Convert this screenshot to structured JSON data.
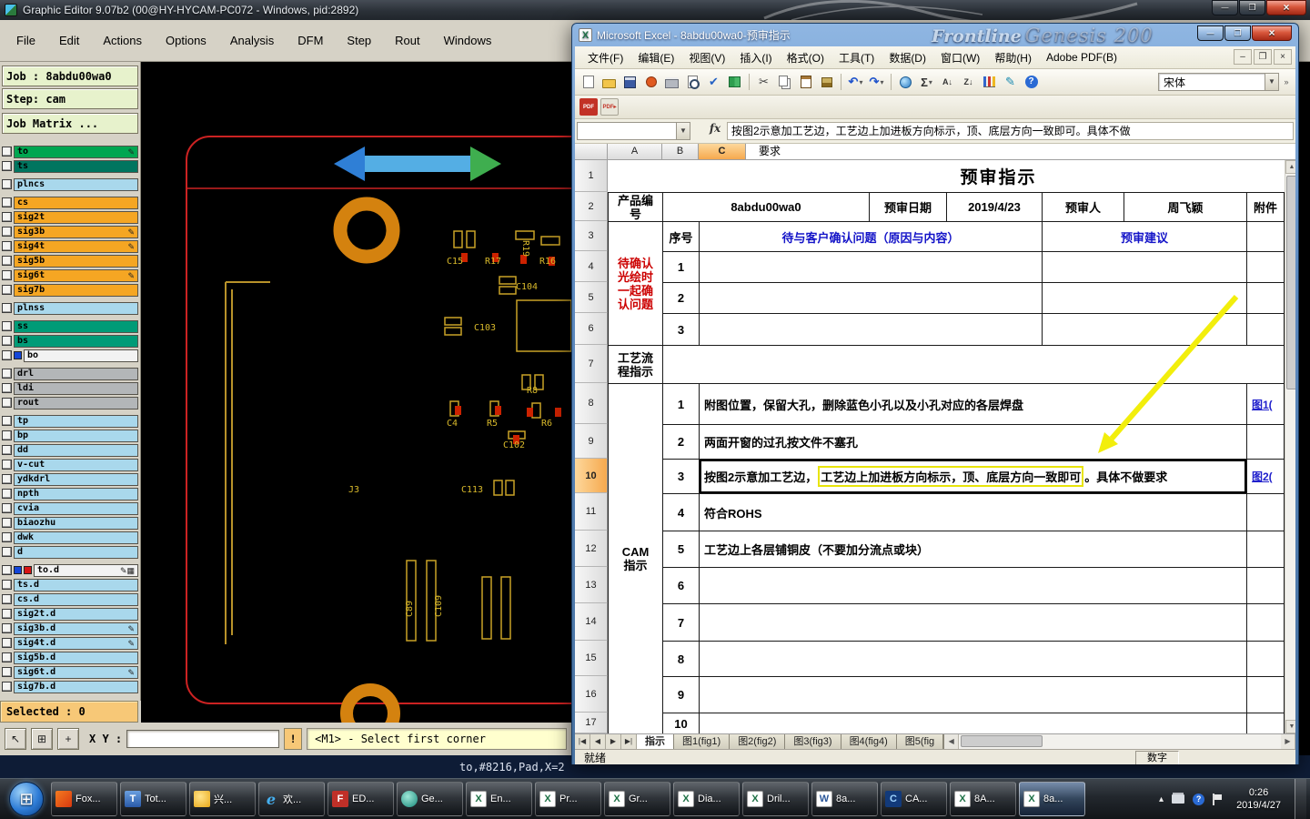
{
  "wallpaper": {
    "brand_italic": "Frontline",
    "brand_rest": "Genesis 200"
  },
  "graphic_editor": {
    "title": "Graphic Editor 9.07b2 (00@HY-HYCAM-PC072 - Windows, pid:2892)",
    "menu_items": [
      "File",
      "Edit",
      "Actions",
      "Options",
      "Analysis",
      "DFM",
      "Step",
      "Rout",
      "Windows"
    ],
    "job_line": "Job : 8abdu00wa0",
    "step_line": "Step: cam",
    "job_matrix_label": "Job Matrix ...",
    "pencil_glyph": "✎",
    "grid_glyph": "▦",
    "layers": [
      {
        "name": "to",
        "color": "#00a651"
      },
      {
        "name": "ts",
        "color": "#00755f"
      },
      {
        "name": "plncs",
        "color": "#a9d8ec"
      },
      {
        "name": "cs",
        "color": "#f5a623"
      },
      {
        "name": "sig2t",
        "color": "#f5a623"
      },
      {
        "name": "sig3b",
        "color": "#f5a623"
      },
      {
        "name": "sig4t",
        "color": "#f5a623"
      },
      {
        "name": "sig5b",
        "color": "#f5a623"
      },
      {
        "name": "sig6t",
        "color": "#f5a623"
      },
      {
        "name": "sig7b",
        "color": "#f5a623"
      },
      {
        "name": "plnss",
        "color": "#a9d8ec"
      },
      {
        "name": "ss",
        "color": "#009b77"
      },
      {
        "name": "bs",
        "color": "#009b77"
      },
      {
        "name": "bo",
        "color": "#f2f2f2"
      },
      {
        "name": "drl",
        "color": "#b3b6b8"
      },
      {
        "name": "ldi",
        "color": "#b3b6b8"
      },
      {
        "name": "rout",
        "color": "#b3b6b8"
      },
      {
        "name": "tp",
        "color": "#a9d8ec"
      },
      {
        "name": "bp",
        "color": "#a9d8ec"
      },
      {
        "name": "dd",
        "color": "#a9d8ec"
      },
      {
        "name": "v-cut",
        "color": "#a9d8ec"
      },
      {
        "name": "ydkdrl",
        "color": "#a9d8ec"
      },
      {
        "name": "npth",
        "color": "#a9d8ec"
      },
      {
        "name": "cvia",
        "color": "#a9d8ec"
      },
      {
        "name": "biaozhu",
        "color": "#a9d8ec"
      },
      {
        "name": "dwk",
        "color": "#a9d8ec"
      },
      {
        "name": "d",
        "color": "#a9d8ec"
      },
      {
        "name": "to.d",
        "color": "#f2f2f2"
      },
      {
        "name": "ts.d",
        "color": "#a9d8ec"
      },
      {
        "name": "cs.d",
        "color": "#a9d8ec"
      },
      {
        "name": "sig2t.d",
        "color": "#a9d8ec"
      },
      {
        "name": "sig3b.d",
        "color": "#a9d8ec"
      },
      {
        "name": "sig4t.d",
        "color": "#a9d8ec"
      },
      {
        "name": "sig5b.d",
        "color": "#a9d8ec"
      },
      {
        "name": "sig6t.d",
        "color": "#a9d8ec"
      },
      {
        "name": "sig7b.d",
        "color": "#a9d8ec"
      }
    ],
    "selected_label": "Selected : 0",
    "xy_label": "X Y :",
    "xy_value": "",
    "alert_glyph": "!",
    "status_message": "<M1> - Select first corner",
    "coord_readout": "to,#8216,Pad,X=2",
    "pcb_labels": [
      "C15",
      "R17",
      "R16",
      "R19",
      "C104",
      "C103",
      "R8",
      "C4",
      "R5",
      "R6",
      "C102",
      "J3",
      "C113",
      "C89",
      "C109"
    ]
  },
  "excel": {
    "window_title": "Microsoft Excel - 8abdu00wa0-预审指示",
    "menu_items": [
      "文件(F)",
      "编辑(E)",
      "视图(V)",
      "插入(I)",
      "格式(O)",
      "工具(T)",
      "数据(D)",
      "窗口(W)",
      "帮助(H)",
      "Adobe PDF(B)"
    ],
    "font_name": "宋体",
    "name_box": "",
    "fx_label": "fx",
    "formula_line1": "按图2示意加工艺边，工艺边上加进板方向标示，顶、底层方向一致即可。具体不做",
    "formula_line2": "要求",
    "col_headers": [
      "A",
      "B",
      "C"
    ],
    "row_headers": [
      "1",
      "2",
      "3",
      "4",
      "5",
      "6",
      "7",
      "8",
      "9",
      "10",
      "11",
      "12",
      "13",
      "14",
      "15",
      "16",
      "17"
    ],
    "table": {
      "title": "预审指示",
      "product_label": "产品编号",
      "product_value": "8abdu00wa0",
      "date_label": "预审日期",
      "date_value": "2019/4/23",
      "reviewer_label": "预审人",
      "reviewer_value": "周飞颖",
      "attach_label": "附件",
      "pending_label": "待确认光绘时一起确认问题",
      "seq_label": "序号",
      "question_header": "待与客户确认问题（原因与内容）",
      "suggest_header": "预审建议",
      "pending_nums": [
        "1",
        "2",
        "3"
      ],
      "process_label": "工艺流程指示",
      "cam_label": "CAM 指示",
      "cam_rows": [
        {
          "num": "1",
          "text": "附图位置，保留大孔，删除蓝色小孔以及小孔对应的各层焊盘",
          "attach": "图1("
        },
        {
          "num": "2",
          "text": "两面开窗的过孔按文件不塞孔",
          "attach": ""
        },
        {
          "num": "3",
          "text_pre": "按图2示意加工艺边，",
          "text_boxed": "工艺边上加进板方向标示，顶、底层方向一致即可",
          "text_post": "。具体不做要求",
          "attach": "图2("
        },
        {
          "num": "4",
          "text": "符合ROHS",
          "attach": ""
        },
        {
          "num": "5",
          "text": "工艺边上各层铺铜皮（不要加分流点或块）",
          "attach": ""
        },
        {
          "num": "6",
          "text": "",
          "attach": ""
        },
        {
          "num": "7",
          "text": "",
          "attach": ""
        },
        {
          "num": "8",
          "text": "",
          "attach": ""
        },
        {
          "num": "9",
          "text": "",
          "attach": ""
        },
        {
          "num": "10",
          "text": "",
          "attach": ""
        }
      ]
    },
    "sheet_tabs": [
      "指示",
      "图1(fig1)",
      "图2(fig2)",
      "图3(fig3)",
      "图4(fig4)",
      "图5(fig"
    ],
    "status_ready": "就绪",
    "status_num": "数字"
  },
  "taskbar": {
    "buttons": [
      {
        "label": "Fox..."
      },
      {
        "label": "Tot..."
      },
      {
        "label": "兴..."
      },
      {
        "label": "欢..."
      },
      {
        "label": "ED..."
      },
      {
        "label": "Ge..."
      },
      {
        "label": "En..."
      },
      {
        "label": "Pr..."
      },
      {
        "label": "Gr..."
      },
      {
        "label": "Dia..."
      },
      {
        "label": "Dril..."
      },
      {
        "label": "8a..."
      },
      {
        "label": "CA..."
      },
      {
        "label": "8A..."
      },
      {
        "label": "8a..."
      }
    ],
    "clock_time": "0:26",
    "clock_date": "2019/4/27"
  }
}
